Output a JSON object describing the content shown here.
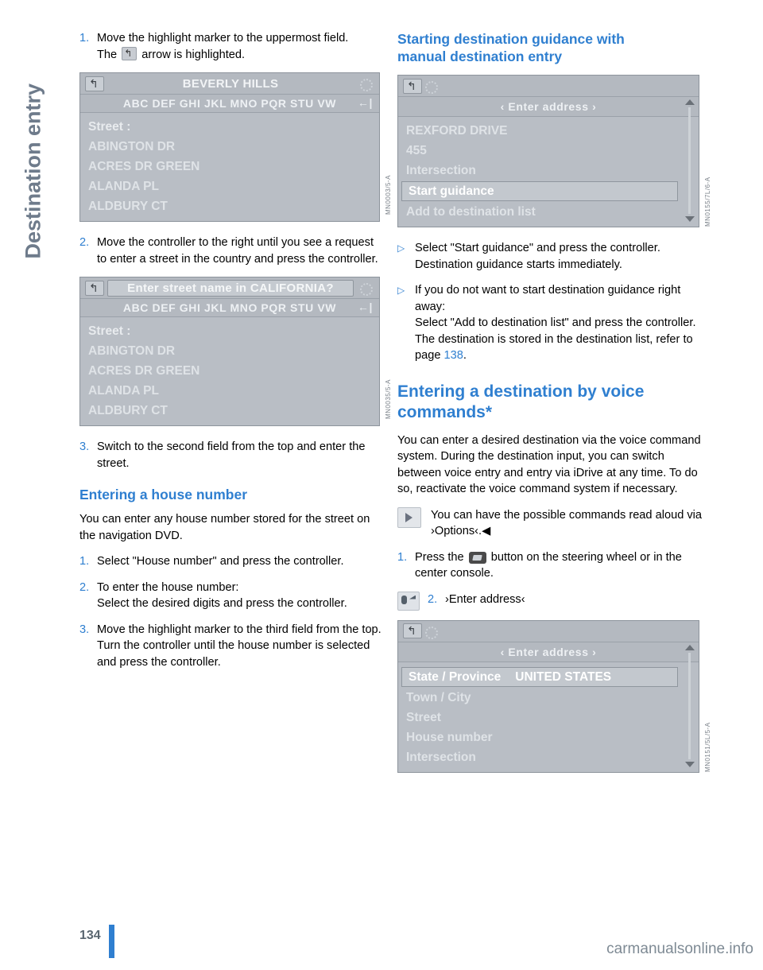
{
  "side_title": "Destination entry",
  "page_number": "134",
  "watermark": "carmanualsonline.info",
  "left_column": {
    "steps": [
      {
        "num": "1.",
        "text_before_glyph": "Move the highlight marker to the uppermost field.",
        "text_line2_a": "The ",
        "text_line2_b": " arrow is highlighted."
      },
      {
        "num": "2.",
        "text": "Move the controller to the right until you see a request to enter a street in the country and press the controller."
      },
      {
        "num": "3.",
        "text": "Switch to the second field from the top and enter the street."
      }
    ],
    "screen1": {
      "title": "BEVERLY HILLS",
      "alphabet": "ABC DEF GHI JKL MNO PQR STU VW",
      "lines": [
        "Street :",
        "ABINGTON DR",
        "ACRES DR GREEN",
        "ALANDA PL",
        "ALDBURY CT"
      ],
      "code": "MN0003/5-A"
    },
    "screen2": {
      "title": "Enter street name in CALIFORNIA?",
      "alphabet": "ABC DEF GHI JKL MNO PQR STU VW",
      "lines": [
        "Street :",
        "ABINGTON DR",
        "ACRES DR GREEN",
        "ALANDA PL",
        "ALDBURY CT"
      ],
      "code": "MN0035/5-A"
    },
    "house_number": {
      "heading": "Entering a house number",
      "intro": "You can enter any house number stored for the street on the navigation DVD.",
      "steps": [
        {
          "num": "1.",
          "text": "Select \"House number\" and press the controller."
        },
        {
          "num": "2.",
          "text": "To enter the house number:\nSelect the desired digits and press the controller."
        },
        {
          "num": "3.",
          "text": "Move the highlight marker to the third field from the top. Turn the controller until the house number is selected and press the controller."
        }
      ]
    }
  },
  "right_column": {
    "heading1": "Starting destination guidance with manual destination entry",
    "screen3": {
      "title": "‹ Enter address ›",
      "lines": [
        "REXFORD DRIVE",
        "455",
        "Intersection"
      ],
      "selected": "Start guidance",
      "line_after": "Add to destination list",
      "code": "MN0155/7L/6-A"
    },
    "bullets": [
      {
        "marker": "▷",
        "text": "Select \"Start guidance\" and press the controller.\nDestination guidance starts immediately."
      },
      {
        "marker": "▷",
        "text_part1": "If you do not want to start destination guidance right away:\nSelect \"Add to destination list\" and press the controller.\nThe destination is stored in the destination list, refer to page ",
        "page_ref": "138",
        "text_part2": "."
      }
    ],
    "heading2": "Entering a destination by voice commands*",
    "paragraph": "You can enter a desired destination via the voice command system. During the destination input, you can switch between voice entry and entry via iDrive at any time. To do so, reactivate the voice command system if necessary.",
    "options_note": "You can have the possible commands read aloud via ›Options‹.◀",
    "voice_steps": [
      {
        "num": "1.",
        "text_a": "Press the ",
        "text_b": " button on the steering wheel or in the center console."
      },
      {
        "num": "2.",
        "text": "›Enter address‹"
      }
    ],
    "screen4": {
      "title": "‹ Enter address ›",
      "row_label": "State / Province",
      "row_value": "UNITED STATES",
      "lines": [
        "Town / City",
        "Street",
        "House number",
        "Intersection"
      ],
      "code": "MN0151/5L/5-A"
    }
  }
}
